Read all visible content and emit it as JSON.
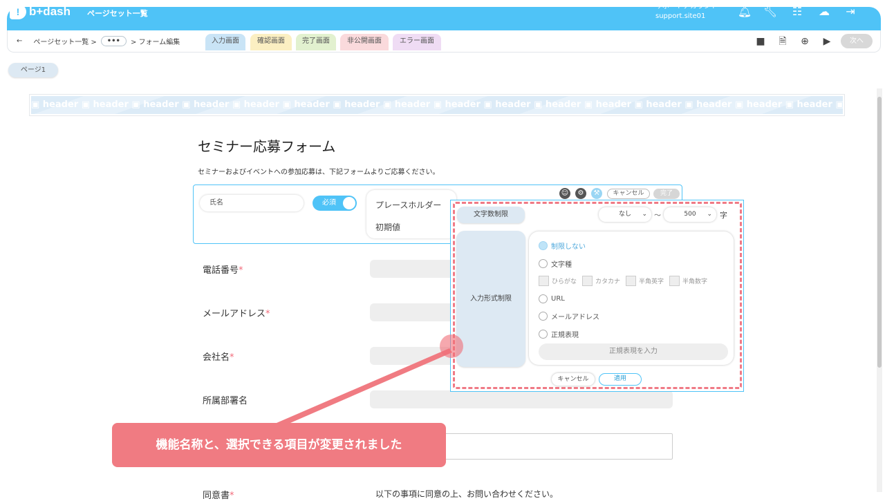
{
  "topbar": {
    "logo_text": "b+dash",
    "app_title": "ページセット一覧",
    "account_name": "サポートアカウント",
    "account_site": "support.site01",
    "accent_color": "#4fc3f7"
  },
  "breadcrumb": {
    "back_label": "←",
    "item1": "ページセット一覧 >",
    "more": "•••",
    "item3": "> フォーム編集"
  },
  "tabs": [
    "入力画面",
    "確認画面",
    "完了画面",
    "非公開画面",
    "エラー画面"
  ],
  "next_label": "次へ",
  "page_tab": "ページ1",
  "header_placeholder": "header",
  "form": {
    "title": "セミナー応募フォーム",
    "description": "セミナーおよびイベントへの参加応募は、下記フォームよりご応募ください。",
    "name_field": "氏名",
    "required_toggle": "必須",
    "placeholder_label": "プレースホルダー",
    "initial_label": "初期値",
    "cancel_top": "キャンセル",
    "done_top": "完了",
    "fields": [
      {
        "label": "電話番号",
        "required": "*"
      },
      {
        "label": "メールアドレス",
        "required": "*"
      },
      {
        "label": "会社名",
        "required": "*"
      },
      {
        "label": "所属部署名",
        "required": ""
      },
      {
        "label": "同意書",
        "required": "*"
      }
    ],
    "consent_text": "以下の事項に同意の上、お問い合わせください。"
  },
  "popup": {
    "char_limit_label": "文字数制限",
    "min_value": "なし",
    "tilde": "～",
    "max_value": "500",
    "char_unit": "字",
    "format_label": "入力形式制限",
    "options": {
      "none": "制限しない",
      "char_type": "文字種",
      "url": "URL",
      "email": "メールアドレス",
      "regex": "正規表現"
    },
    "char_types": [
      "ひらがな",
      "カタカナ",
      "半角英字",
      "半角数字"
    ],
    "regex_button": "正規表現を入力",
    "cancel": "キャンセル",
    "apply": "適用"
  },
  "callout_text": "機能名称と、選択できる項目が変更されました"
}
